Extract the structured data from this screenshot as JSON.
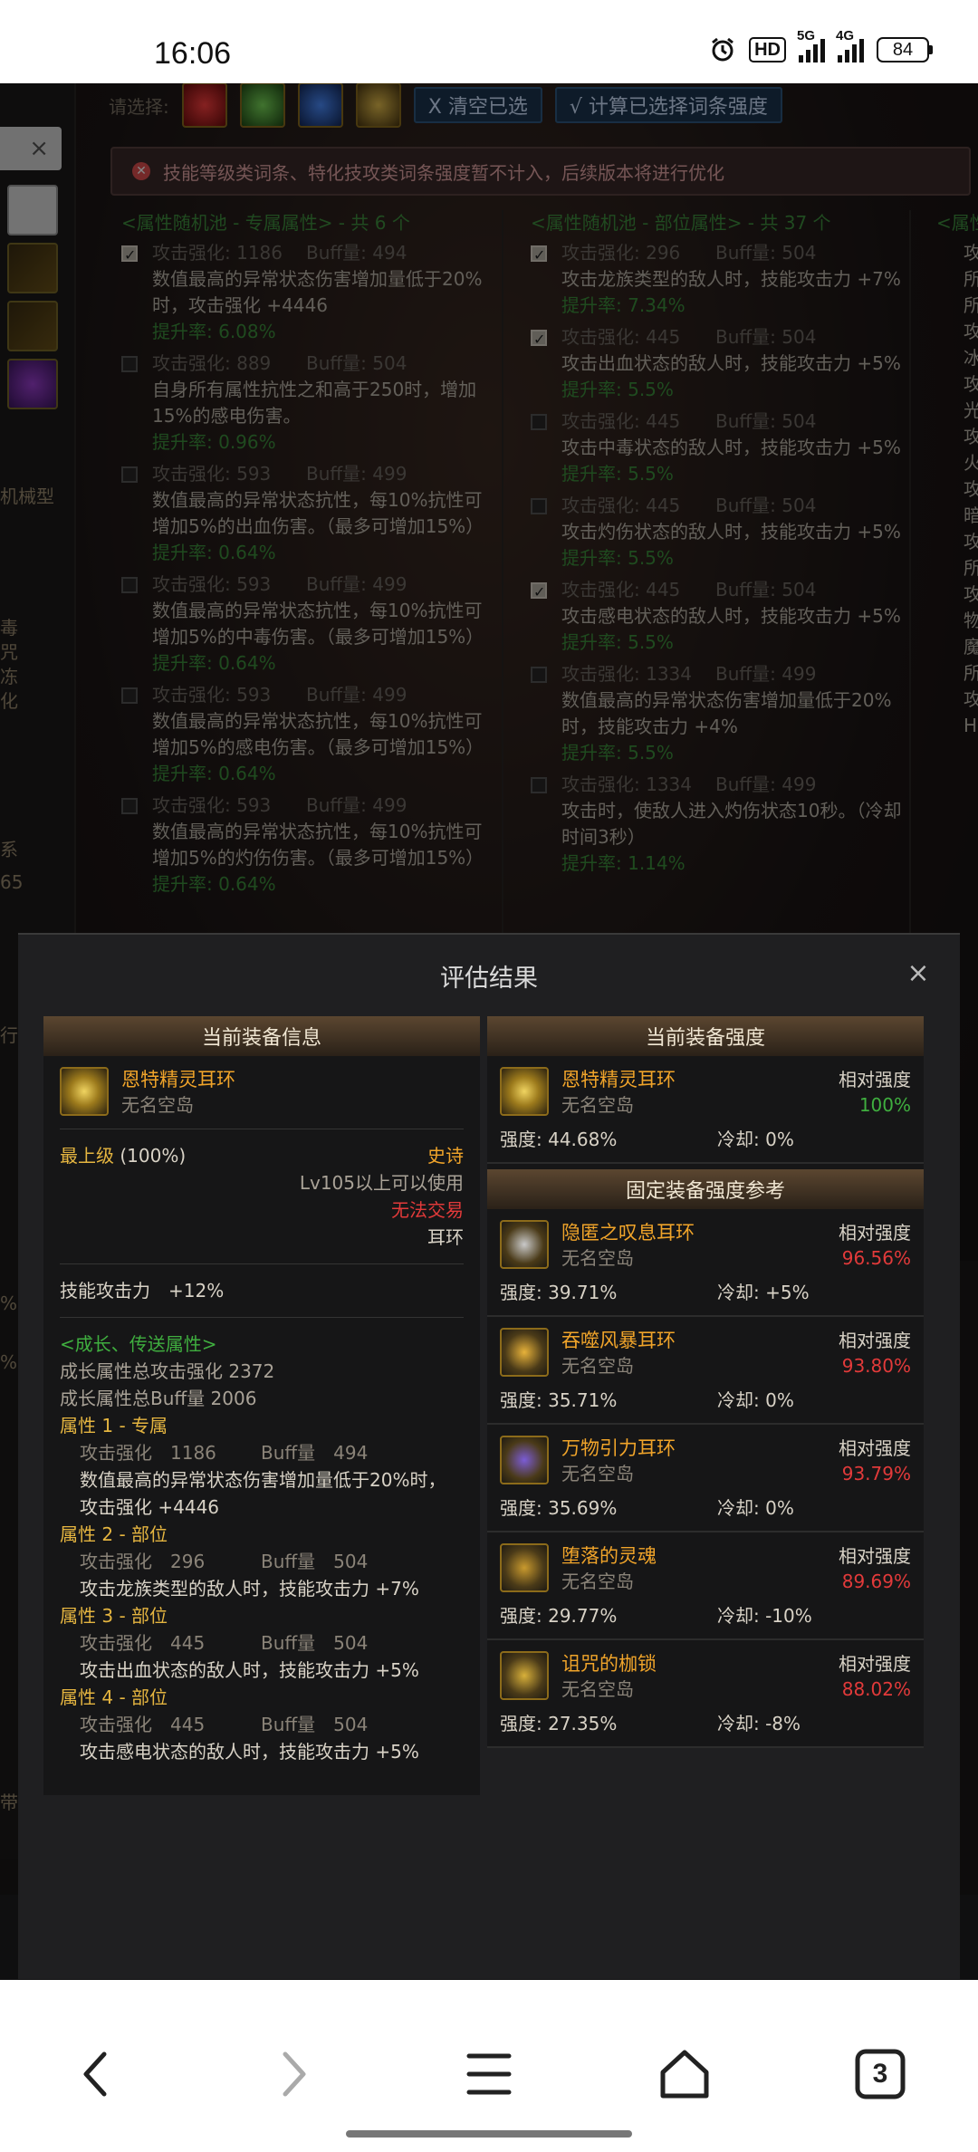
{
  "status_bar": {
    "time": "16:06",
    "hd_label": "HD",
    "net1": "5G",
    "net2": "4G",
    "battery": "84"
  },
  "bg": {
    "dismiss": "×",
    "select_label": "请选择:",
    "clear_btn": "X 清空已选",
    "calc_btn": "√ 计算已选择词条强度",
    "alert_text": "技能等级类词条、特化技攻类词条强度暂不计入，后续版本将进行优化",
    "left_labels": [
      "机械型",
      "毒",
      "咒",
      "冻",
      "化",
      "系",
      "65",
      "行",
      "%",
      "%",
      "带"
    ],
    "pool1": {
      "header": "<属性随机池 - 专属属性> - 共 6 个",
      "entries": [
        {
          "checked": true,
          "atk": "攻击强化: 1186",
          "buff": "Buff量: 494",
          "desc": "数值最高的异常状态伤害增加量低于20%时，攻击强化 +4446",
          "rate": "提升率: 6.08%"
        },
        {
          "checked": false,
          "atk": "攻击强化: 889",
          "buff": "Buff量: 504",
          "desc": "自身所有属性抗性之和高于250时，增加15%的感电伤害。",
          "rate": "提升率: 0.96%"
        },
        {
          "checked": false,
          "atk": "攻击强化: 593",
          "buff": "Buff量: 499",
          "desc": "数值最高的异常状态抗性，每10%抗性可增加5%的出血伤害。（最多可增加15%）",
          "rate": "提升率: 0.64%"
        },
        {
          "checked": false,
          "atk": "攻击强化: 593",
          "buff": "Buff量: 499",
          "desc": "数值最高的异常状态抗性，每10%抗性可增加5%的中毒伤害。（最多可增加15%）",
          "rate": "提升率: 0.64%"
        },
        {
          "checked": false,
          "atk": "攻击强化: 593",
          "buff": "Buff量: 499",
          "desc": "数值最高的异常状态抗性，每10%抗性可增加5%的感电伤害。（最多可增加15%）",
          "rate": "提升率: 0.64%"
        },
        {
          "checked": false,
          "atk": "攻击强化: 593",
          "buff": "Buff量: 499",
          "desc": "数值最高的异常状态抗性，每10%抗性可增加5%的灼伤伤害。（最多可增加15%）",
          "rate": "提升率: 0.64%"
        }
      ]
    },
    "pool2": {
      "header": "<属性随机池 - 部位属性> - 共 37 个",
      "entries": [
        {
          "checked": true,
          "atk": "攻击强化: 296",
          "buff": "Buff量: 504",
          "desc": "攻击龙族类型的敌人时，技能攻击力 +7%",
          "rate": "提升率: 7.34%"
        },
        {
          "checked": true,
          "atk": "攻击强化: 445",
          "buff": "Buff量: 504",
          "desc": "攻击出血状态的敌人时，技能攻击力 +5%",
          "rate": "提升率: 5.5%"
        },
        {
          "checked": false,
          "atk": "攻击强化: 445",
          "buff": "Buff量: 504",
          "desc": "攻击中毒状态的敌人时，技能攻击力 +5%",
          "rate": "提升率: 5.5%"
        },
        {
          "checked": false,
          "atk": "攻击强化: 445",
          "buff": "Buff量: 504",
          "desc": "攻击灼伤状态的敌人时，技能攻击力 +5%",
          "rate": "提升率: 5.5%"
        },
        {
          "checked": true,
          "atk": "攻击强化: 445",
          "buff": "Buff量: 504",
          "desc": "攻击感电状态的敌人时，技能攻击力 +5%",
          "rate": "提升率: 5.5%"
        },
        {
          "checked": false,
          "atk": "攻击强化: 1334",
          "buff": "Buff量: 499",
          "desc": "数值最高的异常状态伤害增加量低于20%时，技能攻击力 +4%",
          "rate": "提升率: 5.5%"
        },
        {
          "checked": false,
          "atk": "攻击强化: 1334",
          "buff": "Buff量: 499",
          "desc": "攻击时，使敌人进入灼伤状态10秒。（冷却时间3秒）",
          "rate": "提升率: 1.14%"
        }
      ]
    },
    "pool3_header": "<属性",
    "pool3_glyphs": [
      "攻",
      "所",
      "所",
      "攻",
      "冰",
      "攻",
      "光",
      "攻",
      "火",
      "攻",
      "暗",
      "攻",
      "所",
      "攻",
      "物",
      "魔",
      "所",
      "攻",
      "H"
    ]
  },
  "modal": {
    "title": "评估结果",
    "close": "×",
    "info": {
      "header": "当前装备信息",
      "item_name": "恩特精灵耳环",
      "item_sub": "无名空岛",
      "grade_label": "最上级",
      "grade_pct": "(100%)",
      "rarity": "史诗",
      "level_req": "Lv105以上可以使用",
      "trade": "无法交易",
      "slot": "耳环",
      "skill_atk": "技能攻击力　+12%",
      "growth_header": "<成长、传送属性>",
      "growth_atk": "成长属性总攻击强化 2372",
      "growth_buff": "成长属性总Buff量 2006",
      "attrs": [
        {
          "title": "属性 1 - 专属",
          "atk": "攻击强化　1186",
          "buff": "Buff量　494",
          "desc": "数值最高的异常状态伤害增加量低于20%时，攻击强化 +4446"
        },
        {
          "title": "属性 2 - 部位",
          "atk": "攻击强化　296",
          "buff": "Buff量　504",
          "desc": "攻击龙族类型的敌人时，技能攻击力 +7%"
        },
        {
          "title": "属性 3 - 部位",
          "atk": "攻击强化　445",
          "buff": "Buff量　504",
          "desc": "攻击出血状态的敌人时，技能攻击力 +5%"
        },
        {
          "title": "属性 4 - 部位",
          "atk": "攻击强化　445",
          "buff": "Buff量　504",
          "desc": "攻击感电状态的敌人时，技能攻击力 +5%"
        }
      ]
    },
    "strength": {
      "header": "当前装备强度",
      "current": {
        "name": "恩特精灵耳环",
        "sub": "无名空岛",
        "rel_label": "相对强度",
        "rel": "100%",
        "strength": "强度: 44.68%",
        "cooldown": "冷却: 0%"
      },
      "ref_header": "固定装备强度参考",
      "refs": [
        {
          "name": "隐匿之叹息耳环",
          "sub": "无名空岛",
          "rel_label": "相对强度",
          "rel": "96.56%",
          "strength": "强度: 39.71%",
          "cooldown": "冷却: +5%",
          "icon_color": "#c9c9c9"
        },
        {
          "name": "吞噬风暴耳环",
          "sub": "无名空岛",
          "rel_label": "相对强度",
          "rel": "93.80%",
          "strength": "强度: 35.71%",
          "cooldown": "冷却: 0%",
          "icon_color": "#e7b23a"
        },
        {
          "name": "万物引力耳环",
          "sub": "无名空岛",
          "rel_label": "相对强度",
          "rel": "93.79%",
          "strength": "强度: 35.69%",
          "cooldown": "冷却: 0%",
          "icon_color": "#7b5cd6"
        },
        {
          "name": "堕落的灵魂",
          "sub": "无名空岛",
          "rel_label": "相对强度",
          "rel": "89.69%",
          "strength": "强度: 29.77%",
          "cooldown": "冷却: -10%",
          "icon_color": "#c99a2e"
        },
        {
          "name": "诅咒的枷锁",
          "sub": "无名空岛",
          "rel_label": "相对强度",
          "rel": "88.02%",
          "strength": "强度: 27.35%",
          "cooldown": "冷却: -8%",
          "icon_color": "#d8b03a"
        }
      ]
    }
  },
  "nav": {
    "tabs_count": "3"
  }
}
